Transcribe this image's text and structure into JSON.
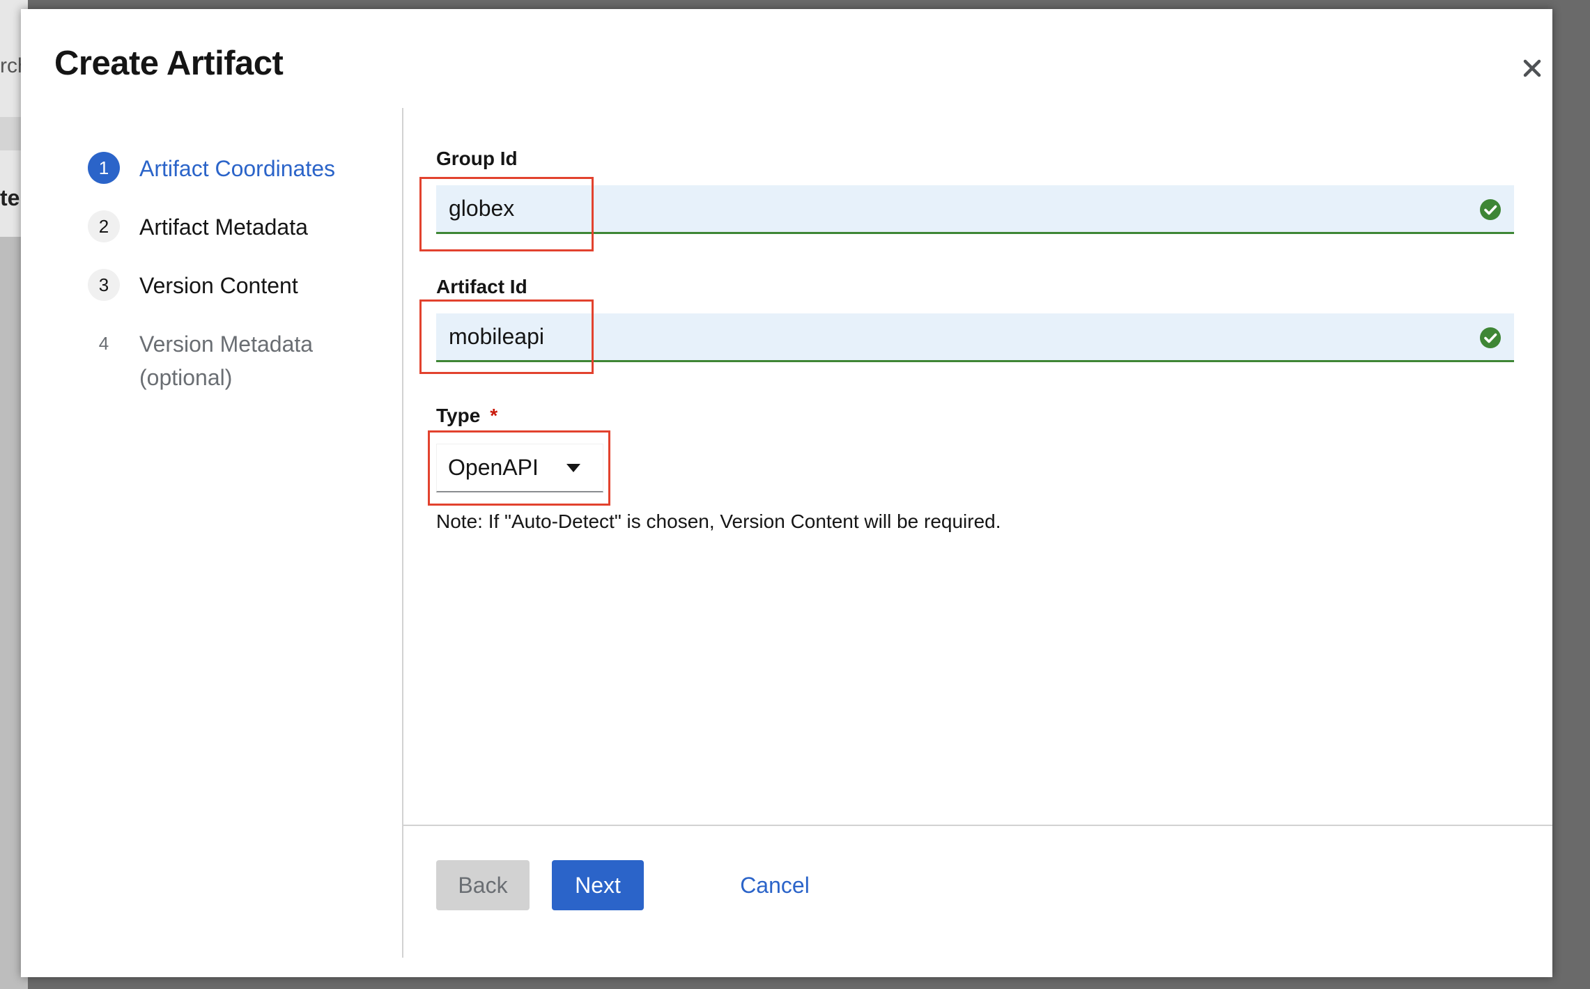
{
  "background": {
    "fragment_top": "rch",
    "fragment_bold": "te"
  },
  "modal": {
    "title": "Create Artifact",
    "close_icon": "close-icon"
  },
  "wizard": {
    "steps": [
      {
        "number": "1",
        "label": "Artifact Coordinates",
        "state": "current"
      },
      {
        "number": "2",
        "label": "Artifact Metadata",
        "state": "default"
      },
      {
        "number": "3",
        "label": "Version Content",
        "state": "default"
      },
      {
        "number": "4",
        "label": "Version Metadata (optional)",
        "state": "disabled"
      }
    ]
  },
  "form": {
    "group_id": {
      "label": "Group Id",
      "value": "globex"
    },
    "artifact_id": {
      "label": "Artifact Id",
      "value": "mobileapi"
    },
    "type": {
      "label": "Type",
      "required_mark": "*",
      "selected": "OpenAPI"
    },
    "note": "Note: If \"Auto-Detect\" is chosen, Version Content will be required."
  },
  "footer": {
    "back_label": "Back",
    "next_label": "Next",
    "cancel_label": "Cancel"
  },
  "colors": {
    "primary": "#2b64c9",
    "success": "#3e8635",
    "highlight": "#e2422e",
    "required": "#c9190b"
  }
}
